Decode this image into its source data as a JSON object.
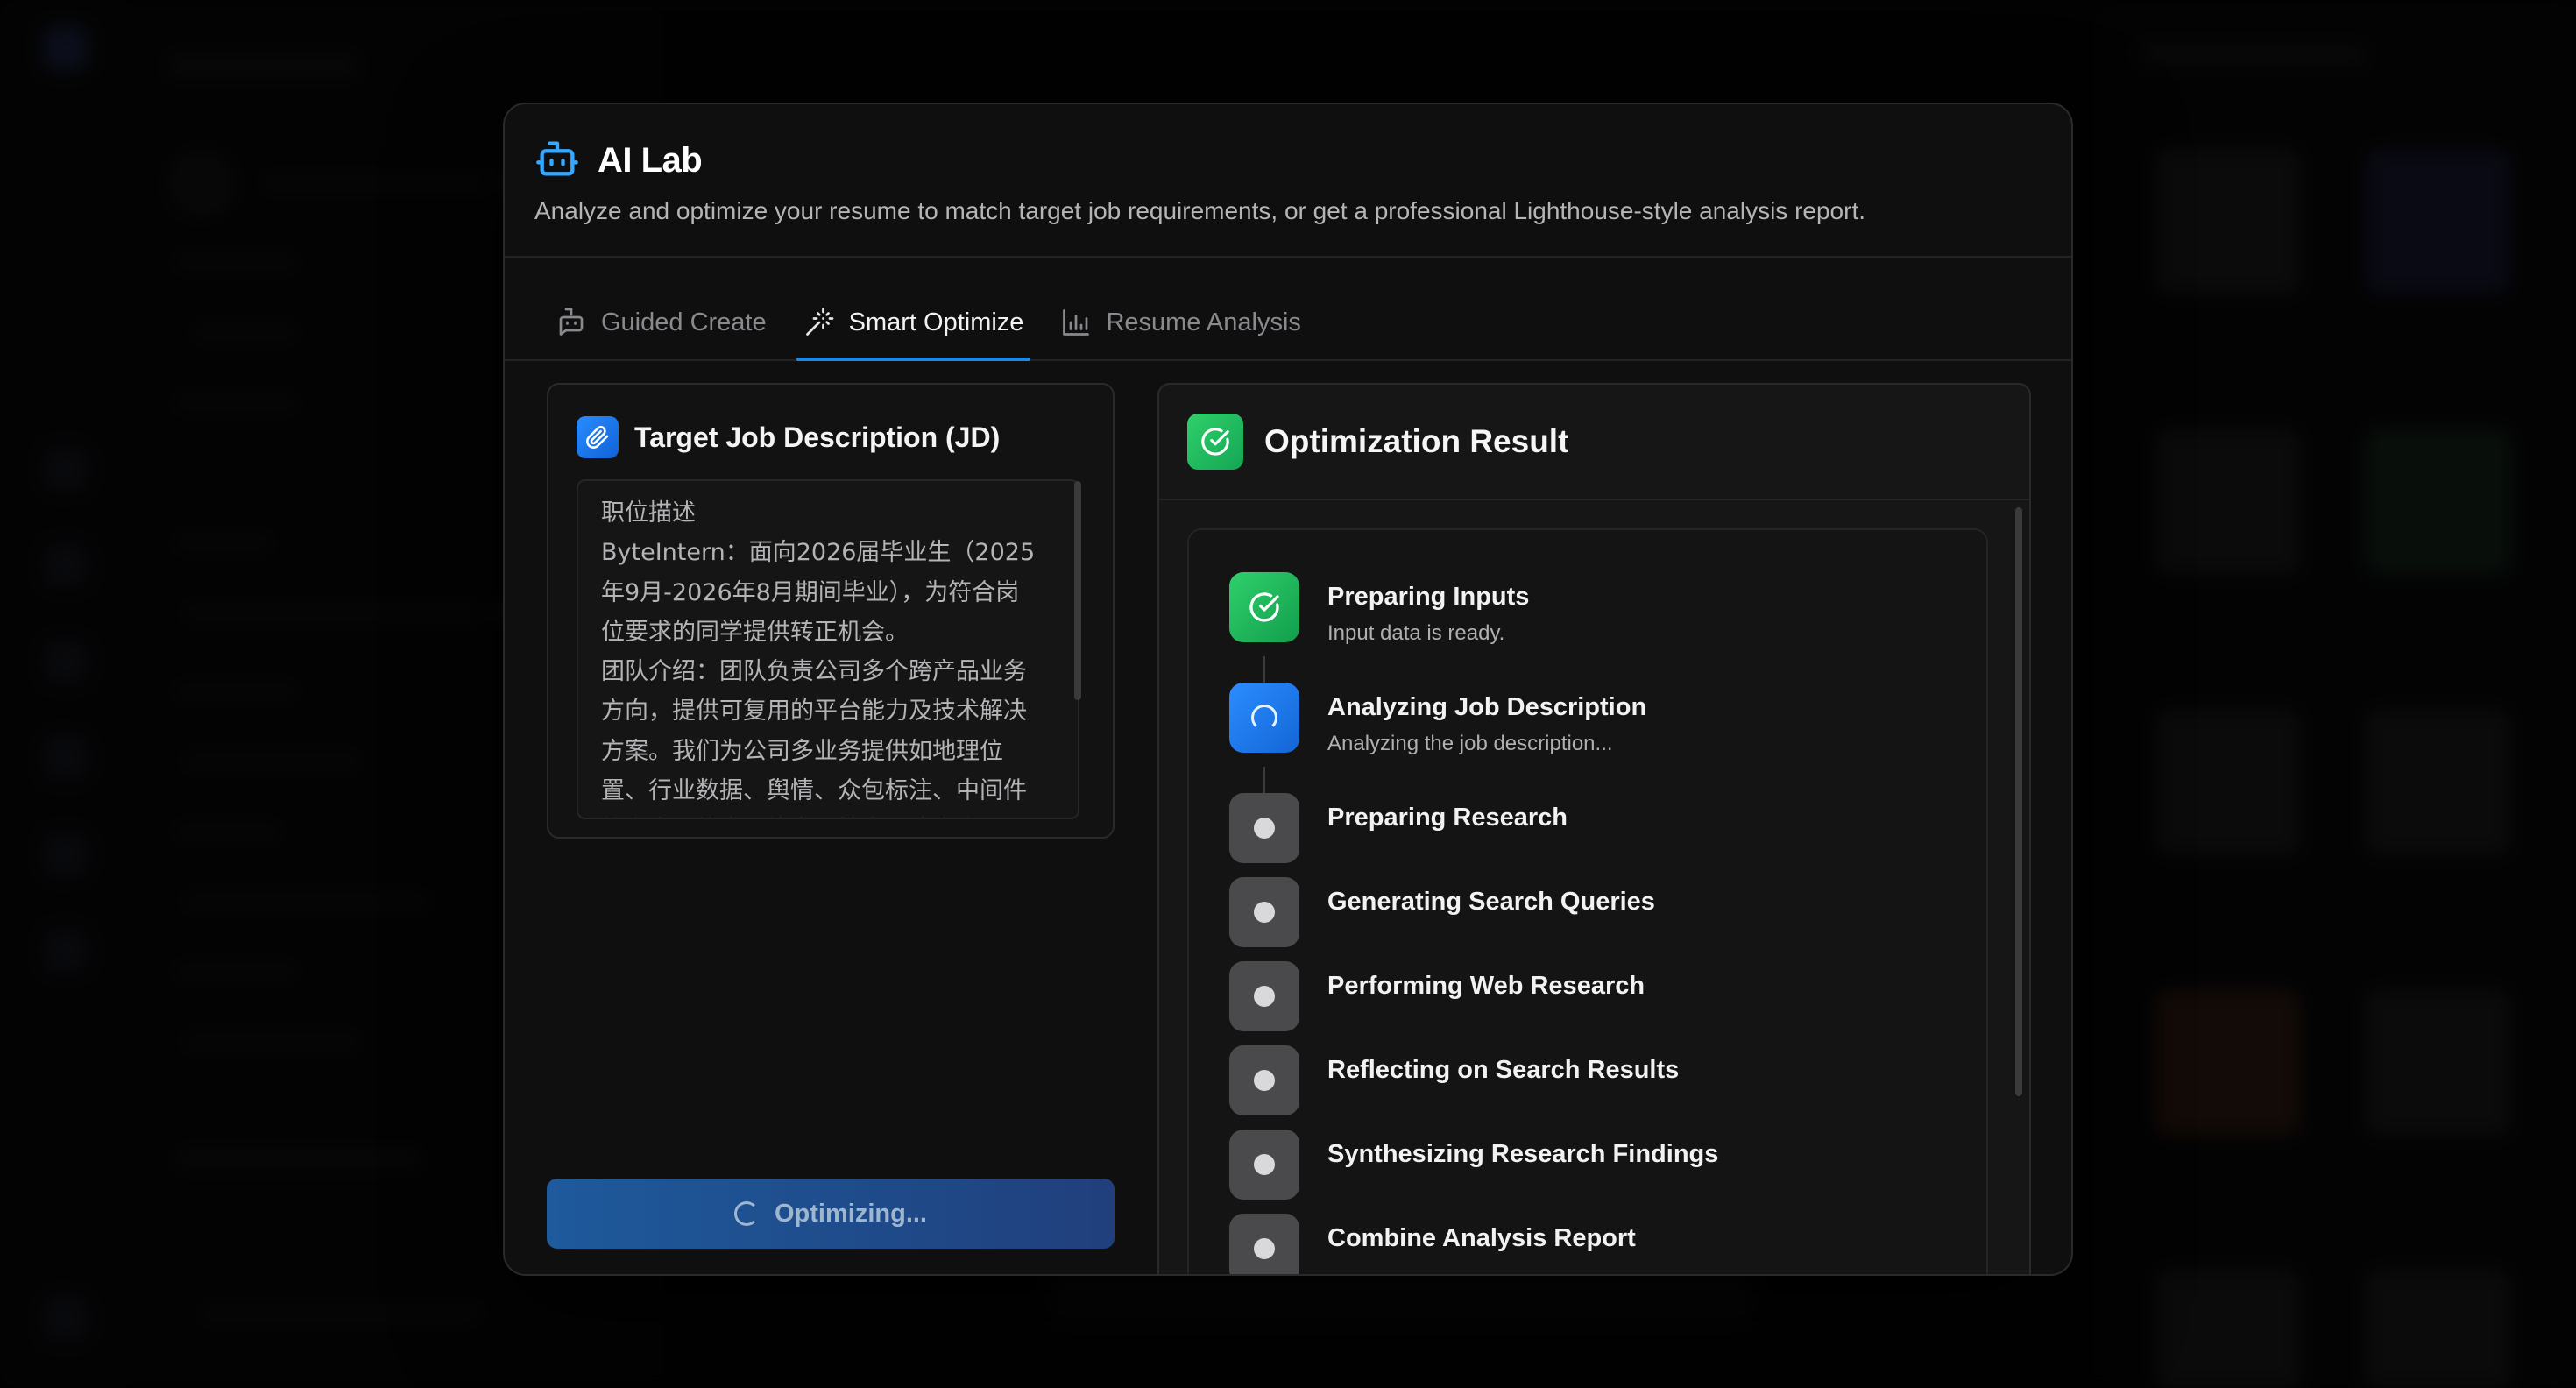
{
  "modal": {
    "title": "AI Lab",
    "subtitle": "Analyze and optimize your resume to match target job requirements, or get a professional Lighthouse-style analysis report."
  },
  "tabs": [
    {
      "label": "Guided Create",
      "icon": "chat-bubble-icon",
      "active": false
    },
    {
      "label": "Smart Optimize",
      "icon": "magic-wand-icon",
      "active": true
    },
    {
      "label": "Resume Analysis",
      "icon": "bar-chart-icon",
      "active": false
    }
  ],
  "jd": {
    "title": "Target Job Description (JD)",
    "text": "职位描述\nByteIntern：面向2026届毕业生（2025年9月-2026年8月期间毕业），为符合岗位要求的同学提供转正机会。\n团队介绍：团队负责公司多个跨产品业务方向，提供可复用的平台能力及技术解决方案。我们为公司多业务提供如地理位置、行业数据、舆情、众包标注、中间件等多类型的中台能力与技术解决方案，积极利用AI等技术做中台能力提效与升级。加入我们，你将有机会从中台的多视角参与业务建设，感受不同类型/阶段的业务特点；通过投身亿级用户场景的开发&架构工作，学习和解决极富挑战的技术问题；你也可以从数据出发，积极利用策略和模"
  },
  "optimize_button": {
    "label": "Optimizing..."
  },
  "result": {
    "title": "Optimization Result",
    "steps": [
      {
        "label": "Preparing Inputs",
        "desc": "Input data is ready.",
        "status": "done"
      },
      {
        "label": "Analyzing Job Description",
        "desc": "Analyzing the job description...",
        "status": "active"
      },
      {
        "label": "Preparing Research",
        "desc": "",
        "status": "pending"
      },
      {
        "label": "Generating Search Queries",
        "desc": "",
        "status": "pending"
      },
      {
        "label": "Performing Web Research",
        "desc": "",
        "status": "pending"
      },
      {
        "label": "Reflecting on Search Results",
        "desc": "",
        "status": "pending"
      },
      {
        "label": "Synthesizing Research Findings",
        "desc": "",
        "status": "pending"
      },
      {
        "label": "Combine Analysis Report",
        "desc": "",
        "status": "pending"
      }
    ]
  },
  "colors": {
    "accent_blue": "#1e88e5",
    "success_green": "#22c55e",
    "modal_bg": "#0f0f10"
  }
}
